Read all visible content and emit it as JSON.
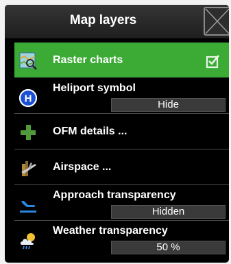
{
  "header": {
    "title": "Map layers"
  },
  "items": [
    {
      "label": "Raster charts",
      "icon": "raster-chart-icon",
      "checked": true
    },
    {
      "label": "Heliport symbol",
      "icon": "heliport-icon",
      "value": "Hide"
    },
    {
      "label": "OFM details ...",
      "icon": "plus-icon"
    },
    {
      "label": "Airspace ...",
      "icon": "airspace-icon"
    },
    {
      "label": "Approach transparency",
      "icon": "approach-icon",
      "value": "Hidden"
    },
    {
      "label": "Weather transparency",
      "icon": "weather-icon",
      "value": "50 %"
    }
  ],
  "colors": {
    "active_row": "#3cab35",
    "background": "#000000"
  }
}
